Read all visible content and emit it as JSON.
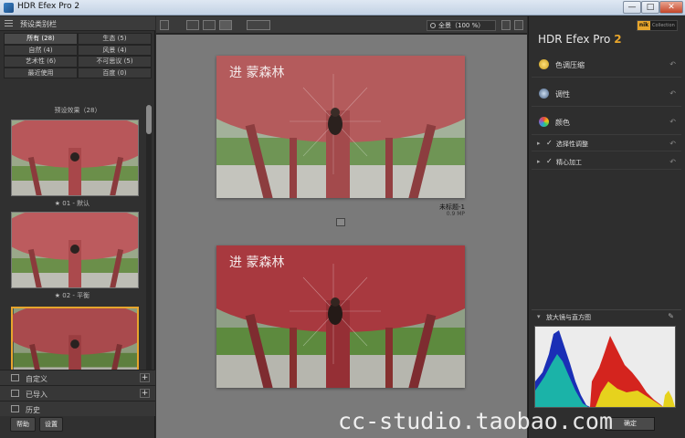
{
  "window": {
    "title": "HDR Efex Pro 2",
    "minimize": "—",
    "maximize": "□",
    "close": "✕"
  },
  "left_panel": {
    "header": "预设类别栏",
    "categories": [
      {
        "label": "所有 (28)",
        "active": true
      },
      {
        "label": "生态 (5)"
      },
      {
        "label": "自然 (4)"
      },
      {
        "label": "风景 (4)"
      },
      {
        "label": "艺术性 (6)"
      },
      {
        "label": "不可思议 (5)"
      },
      {
        "label": "最近使用"
      },
      {
        "label": "百度 (0)"
      }
    ],
    "presets_title": "预设效果（28）",
    "presets": [
      {
        "caption": "★ 01 - 默认"
      },
      {
        "caption": "★ 02 - 平衡"
      },
      {
        "caption": ""
      }
    ],
    "rows": [
      {
        "label": "自定义"
      },
      {
        "label": "已导入"
      },
      {
        "label": "历史"
      }
    ],
    "buttons": {
      "help": "帮助",
      "settings": "设置"
    }
  },
  "toolbar": {
    "zoom": "全景（100 %）"
  },
  "canvas": {
    "image_name": "未标题-1",
    "image_size": "0.9 MP",
    "photo_text": "进 蒙森林"
  },
  "right_panel": {
    "brand": "HDR Efex Pro",
    "brand_version": "2",
    "nik_badge": "nik",
    "nik_sub": "Collection",
    "sections": [
      {
        "label": "色调压缩",
        "icon": "sun-icon",
        "color": "#e7c23a"
      },
      {
        "label": "调性",
        "icon": "tonality-icon",
        "color": "#6a8fb7"
      },
      {
        "label": "颜色",
        "icon": "color-wheel-icon",
        "color": "#c07fd6"
      }
    ],
    "subsections": [
      {
        "label": "选择性调整"
      },
      {
        "label": "精心加工"
      }
    ],
    "histogram_label": "放大镜与直方图",
    "ok": "确定"
  },
  "watermark": "cc-studio.taobao.com"
}
